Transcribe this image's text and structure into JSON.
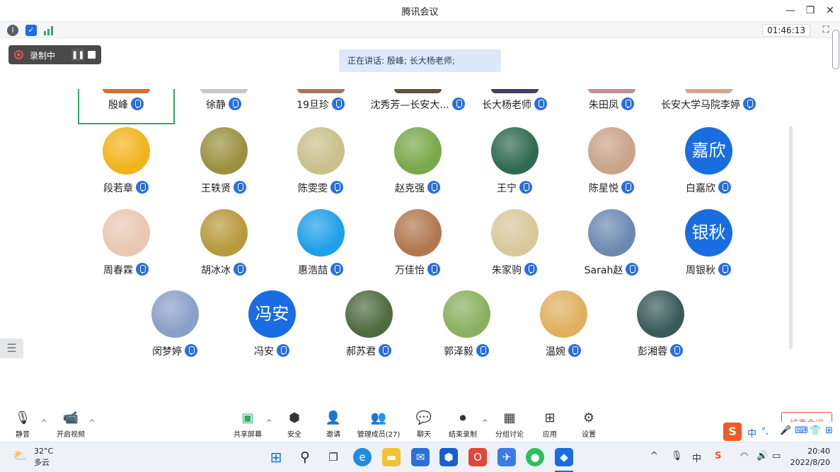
{
  "window": {
    "title": "腾讯会议",
    "minimize": "—",
    "restore": "❐",
    "close": "✕"
  },
  "infobar": {
    "timer": "01:46:13",
    "fullscreen": "⛶"
  },
  "recording": {
    "label": "录制中"
  },
  "speaking": {
    "text": "正在讲话: 殷峰; 长大杨老师;"
  },
  "top_row": [
    {
      "name": "殷峰"
    },
    {
      "name": "徐静"
    },
    {
      "name": "19旦珍"
    },
    {
      "name": "沈秀芳—长安大..."
    },
    {
      "name": "长大杨老师"
    },
    {
      "name": "朱田凤"
    },
    {
      "name": "长安大学马院李婷"
    }
  ],
  "participants": [
    {
      "name": "段若章",
      "color": "#f1b41c"
    },
    {
      "name": "王轶贤",
      "color": "#9a9140"
    },
    {
      "name": "陈雯雯",
      "color": "#c9c08a"
    },
    {
      "name": "赵克强",
      "color": "#7aa84c"
    },
    {
      "name": "王宁",
      "color": "#2f6b50"
    },
    {
      "name": "陈星悦",
      "color": "#c9a38a"
    },
    {
      "name": "白嘉欣",
      "text": "嘉欣",
      "color": "#1a6de0"
    },
    {
      "name": "周春霖",
      "color": "#e8c8b2"
    },
    {
      "name": "胡冰冰",
      "color": "#b79a3e"
    },
    {
      "name": "惠浩喆",
      "color": "#1ea0e8"
    },
    {
      "name": "万佳怡",
      "color": "#b17850"
    },
    {
      "name": "朱家驹",
      "color": "#d8c89a"
    },
    {
      "name": "Sarah赵",
      "color": "#6c8ab0"
    },
    {
      "name": "周银秋",
      "text": "银秋",
      "color": "#1a6de0"
    },
    {
      "name": "闵梦婷",
      "color": "#8aa0c8"
    },
    {
      "name": "冯安",
      "text": "冯安",
      "color": "#1a6de0"
    },
    {
      "name": "郝苏君",
      "color": "#4f6b40"
    },
    {
      "name": "郭泽毅",
      "color": "#8ab060"
    },
    {
      "name": "温婉",
      "color": "#e0b060"
    },
    {
      "name": "彭湘蓉",
      "color": "#3a5a5a"
    }
  ],
  "toolbar": {
    "mute": "静音",
    "video": "开启视频",
    "share": "共享屏幕",
    "security": "安全",
    "invite": "邀请",
    "members": "管理成员(27)",
    "chat": "聊天",
    "end_record": "结束录制",
    "breakout": "分组讨论",
    "apps": "应用",
    "settings": "设置",
    "end_meeting": "结束会议"
  },
  "ime": {
    "lang": "中",
    "punct": "°,"
  },
  "taskbar": {
    "temp": "32°C",
    "weather": "多云",
    "time": "20:40",
    "date": "2022/8/20",
    "ime_indicator": "中"
  }
}
